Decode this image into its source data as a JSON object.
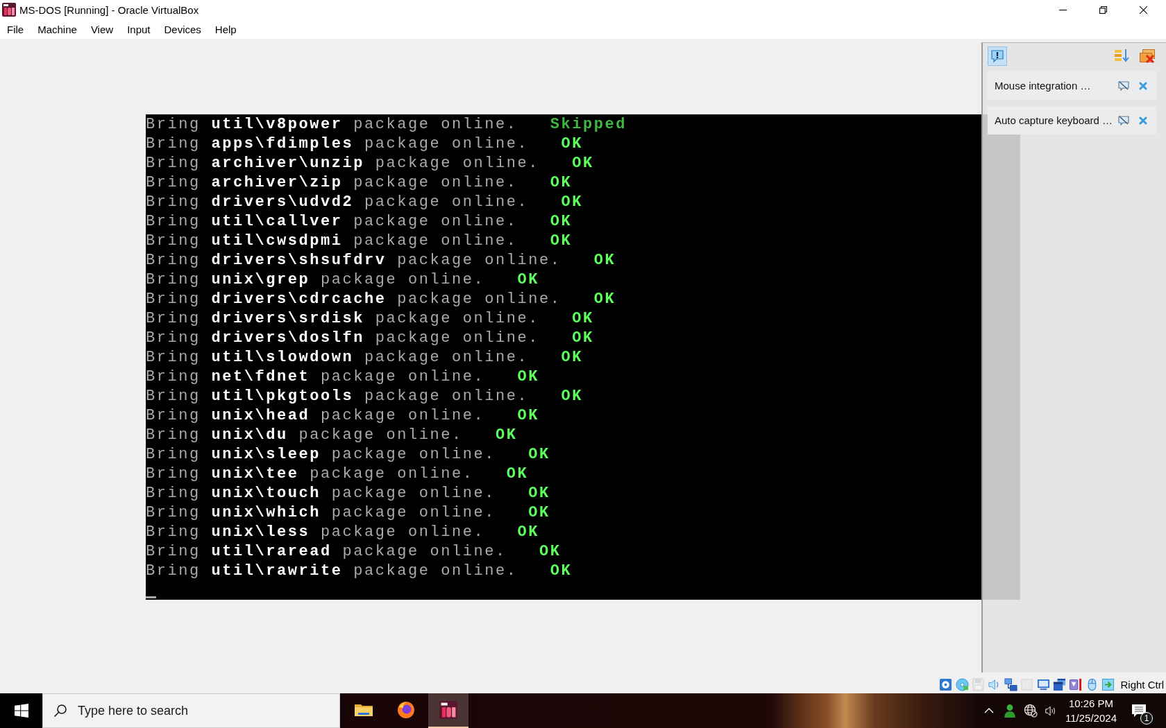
{
  "window": {
    "title": "MS-DOS [Running] - Oracle VirtualBox"
  },
  "menu": [
    "File",
    "Machine",
    "View",
    "Input",
    "Devices",
    "Help"
  ],
  "console": {
    "lines": [
      {
        "text": "Bring **util\\v8power** package online.",
        "status": "Skipped",
        "color": "#40b840"
      },
      {
        "text": "Bring **apps\\fdimples** package online.",
        "status": "OK",
        "color": "#5cff5c"
      },
      {
        "text": "Bring **archiver\\unzip** package online.",
        "status": "OK",
        "color": "#5cff5c"
      },
      {
        "text": "Bring **archiver\\zip** package online.",
        "status": "OK",
        "color": "#5cff5c"
      },
      {
        "text": "Bring **drivers\\udvd2** package online.",
        "status": "OK",
        "color": "#5cff5c"
      },
      {
        "text": "Bring **util\\callver** package online.",
        "status": "OK",
        "color": "#5cff5c"
      },
      {
        "text": "Bring **util\\cwsdpmi** package online.",
        "status": "OK",
        "color": "#5cff5c"
      },
      {
        "text": "Bring **drivers\\shsufdrv** package online.",
        "status": "OK",
        "color": "#5cff5c"
      },
      {
        "text": "Bring **unix\\grep** package online.",
        "status": "OK",
        "color": "#5cff5c"
      },
      {
        "text": "Bring **drivers\\cdrcache** package online.",
        "status": "OK",
        "color": "#5cff5c"
      },
      {
        "text": "Bring **drivers\\srdisk** package online.",
        "status": "OK",
        "color": "#5cff5c"
      },
      {
        "text": "Bring **drivers\\doslfn** package online.",
        "status": "OK",
        "color": "#5cff5c"
      },
      {
        "text": "Bring **util\\slowdown** package online.",
        "status": "OK",
        "color": "#5cff5c"
      },
      {
        "text": "Bring **net\\fdnet** package online.",
        "status": "OK",
        "color": "#5cff5c"
      },
      {
        "text": "Bring **util\\pkgtools** package online.",
        "status": "OK",
        "color": "#5cff5c"
      },
      {
        "text": "Bring **unix\\head** package online.",
        "status": "OK",
        "color": "#5cff5c"
      },
      {
        "text": "Bring **unix\\du** package online.",
        "status": "OK",
        "color": "#5cff5c"
      },
      {
        "text": "Bring **unix\\sleep** package online.",
        "status": "OK",
        "color": "#5cff5c"
      },
      {
        "text": "Bring **unix\\tee** package online.",
        "status": "OK",
        "color": "#5cff5c"
      },
      {
        "text": "Bring **unix\\touch** package online.",
        "status": "OK",
        "color": "#5cff5c"
      },
      {
        "text": "Bring **unix\\which** package online.",
        "status": "OK",
        "color": "#5cff5c"
      },
      {
        "text": "Bring **unix\\less** package online.",
        "status": "OK",
        "color": "#5cff5c"
      },
      {
        "text": "Bring **util\\raread** package online.",
        "status": "OK",
        "color": "#5cff5c"
      },
      {
        "text": "Bring **util\\rawrite** package online.",
        "status": "OK",
        "color": "#5cff5c"
      }
    ]
  },
  "notification_center": {
    "toggle_button": {
      "on": true
    },
    "items": [
      "Mouse integration …",
      "Auto capture keyboard …"
    ]
  },
  "status_bar": {
    "indicators": [
      {
        "kind": "hard-disk",
        "disabled": false
      },
      {
        "kind": "optical-drive",
        "disabled": false
      },
      {
        "kind": "floppy",
        "disabled": true
      },
      {
        "kind": "audio",
        "disabled": false
      },
      {
        "kind": "network",
        "disabled": false
      },
      {
        "kind": "usb",
        "disabled": true
      },
      {
        "kind": "shared-folders",
        "disabled": false
      },
      {
        "kind": "display",
        "disabled": false
      },
      {
        "kind": "recording",
        "disabled": false
      },
      {
        "kind": "mouse-integration",
        "disabled": false
      },
      {
        "kind": "keyboard-capture",
        "disabled": false
      }
    ],
    "host_key": "Right Ctrl"
  },
  "taskbar": {
    "search": {
      "placeholder": "Type here to search"
    },
    "apps": [
      {
        "kind": "folder",
        "selected": false
      },
      {
        "kind": "browser",
        "selected": false
      },
      {
        "kind": "dos",
        "selected": true
      }
    ],
    "time": "10:26 PM",
    "date": "11/25/2024",
    "notification_count": "1"
  }
}
